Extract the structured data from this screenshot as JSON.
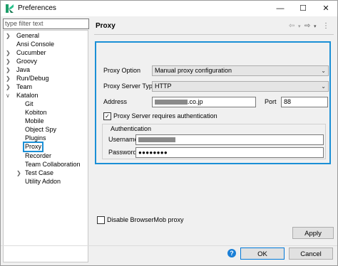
{
  "window": {
    "title": "Preferences",
    "min_glyph": "—",
    "max_glyph": "☐",
    "close_glyph": "✕"
  },
  "sidebar": {
    "filter_placeholder": "type filter text",
    "items": [
      {
        "label": "General",
        "expandable": true
      },
      {
        "label": "Ansi Console",
        "expandable": false
      },
      {
        "label": "Cucumber",
        "expandable": true
      },
      {
        "label": "Groovy",
        "expandable": true
      },
      {
        "label": "Java",
        "expandable": true
      },
      {
        "label": "Run/Debug",
        "expandable": true
      },
      {
        "label": "Team",
        "expandable": true
      },
      {
        "label": "Katalon",
        "expandable": true,
        "expanded": true
      },
      {
        "label": "Git",
        "child": true
      },
      {
        "label": "Kobiton",
        "child": true
      },
      {
        "label": "Mobile",
        "child": true
      },
      {
        "label": "Object Spy",
        "child": true
      },
      {
        "label": "Plugins",
        "child": true
      },
      {
        "label": "Proxy",
        "child": true,
        "selected": true
      },
      {
        "label": "Recorder",
        "child": true
      },
      {
        "label": "Team Collaboration",
        "child": true
      },
      {
        "label": "Test Case",
        "child": true,
        "expandable": true
      },
      {
        "label": "Utility Addon",
        "child": true
      }
    ]
  },
  "page": {
    "title": "Proxy",
    "proxy_option_label": "Proxy Option",
    "proxy_option_value": "Manual proxy configuration",
    "server_type_label": "Proxy Server Type",
    "server_type_value": "HTTP",
    "address_label": "Address",
    "address_value_suffix": ".co.jp",
    "port_label": "Port",
    "port_value": "88",
    "auth_required_label": "Proxy Server requires authentication",
    "auth_required_checked": true,
    "auth_group_title": "Authentication",
    "username_label": "Username",
    "password_label": "Password",
    "password_value": "●●●●●●●●",
    "disable_browsermob_label": "Disable BrowserMob proxy",
    "disable_browsermob_checked": false,
    "apply_label": "Apply"
  },
  "footer": {
    "help_glyph": "?",
    "ok_label": "OK",
    "cancel_label": "Cancel"
  },
  "colors": {
    "highlight": "#1a8fd6",
    "help_icon": "#1a7fd6"
  }
}
